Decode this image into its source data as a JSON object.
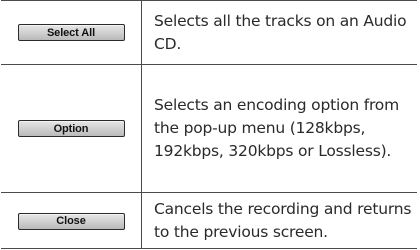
{
  "rows": [
    {
      "button_label": "Select All",
      "description": "Selects all the tracks on an Audio CD."
    },
    {
      "button_label": "Option",
      "description": "Selects an encoding option from the pop-up menu (128kbps, 192kbps, 320kbps or Lossless)."
    },
    {
      "button_label": "Close",
      "description": "Cancels the recording and returns to the previous screen."
    }
  ]
}
